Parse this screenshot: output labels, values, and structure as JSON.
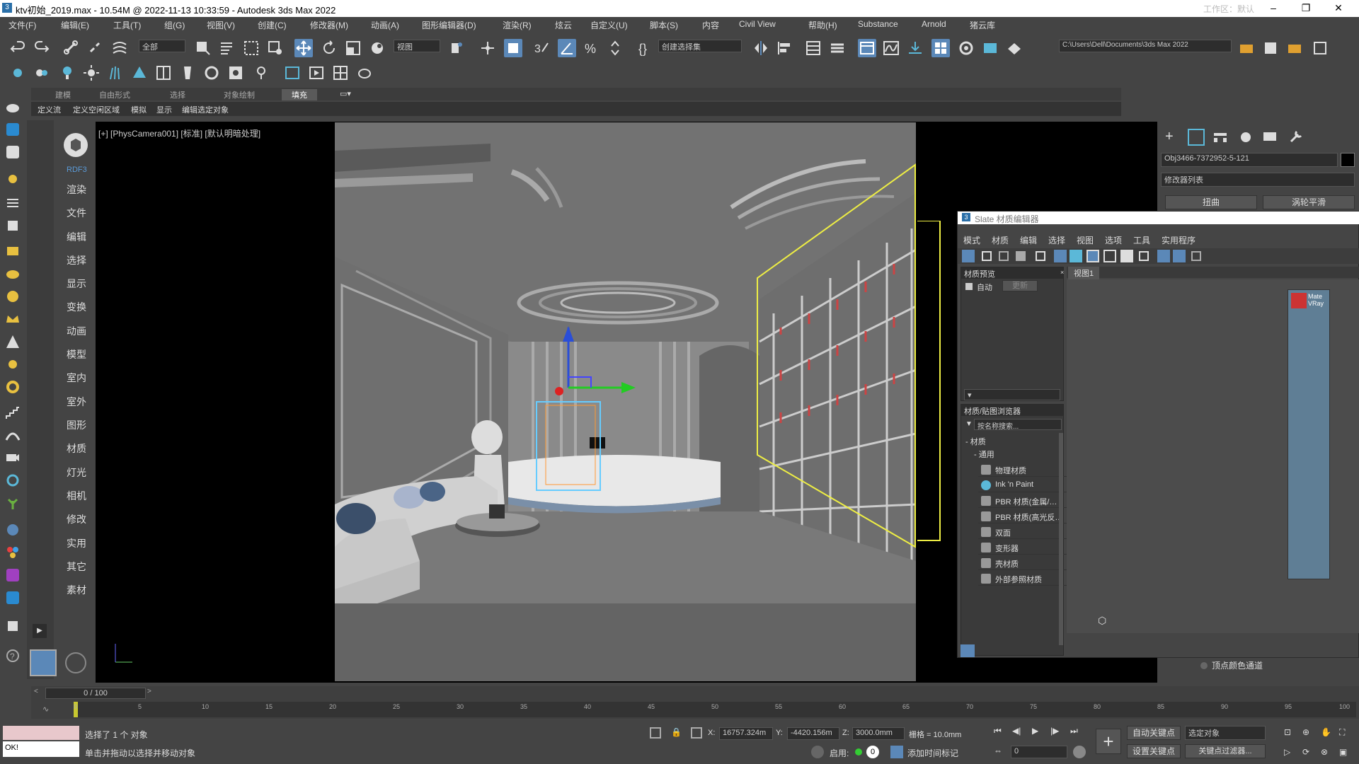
{
  "titlebar": {
    "title": "ktv初始_2019.max - 10.54M @ 2022-11-13 10:33:59 - Autodesk 3ds Max 2022",
    "overlay": "工作区：默认"
  },
  "menus": [
    "文件(F)",
    "编辑(E)",
    "工具(T)",
    "组(G)",
    "视图(V)",
    "创建(C)",
    "修改器(M)",
    "动画(A)",
    "图形编辑器(D)",
    "渲染(R)",
    "炫云",
    "自定义(U)",
    "脚本(S)",
    "内容",
    "Civil View",
    "帮助(H)",
    "Substance",
    "Arnold",
    "猪云库"
  ],
  "toolbar": {
    "selection_filter": "全部",
    "view_dropdown": "视图",
    "named_selection": "创建选择集",
    "path": "C:\\Users\\Dell\\Documents\\3ds Max 2022"
  },
  "ribbon": {
    "tabs": [
      "建模",
      "自由形式",
      "选择",
      "对象绘制",
      "填充"
    ],
    "tools": [
      "定义流",
      "定义空闲区域",
      "模拟",
      "显示",
      "编辑选定对象"
    ]
  },
  "leftpanel": {
    "logo": "RDF3",
    "items": [
      "渲染",
      "文件",
      "编辑",
      "选择",
      "显示",
      "变换",
      "动画",
      "模型",
      "室内",
      "室外",
      "图形",
      "材质",
      "灯光",
      "相机",
      "修改",
      "实用",
      "其它",
      "素材"
    ]
  },
  "viewport": {
    "label": "[+] [PhysCamera001] [标准] [默认明暗处理]"
  },
  "gizmo": {
    "z": "z",
    "y": "y"
  },
  "cmdpanel": {
    "object_name": "Obj3466-7372952-5-121",
    "modifier_list": "修改器列表",
    "btn1": "扭曲",
    "btn2": "涡轮平滑",
    "vertex_color": "顶点颜色通道"
  },
  "slate": {
    "title": "Slate 材质编辑器",
    "menu": [
      "模式",
      "材质",
      "编辑",
      "选择",
      "视图",
      "选项",
      "工具",
      "实用程序"
    ],
    "preview_title": "材质预览",
    "auto": "自动",
    "update": "更新",
    "view_tab": "视图1",
    "browser_title": "材质/贴图浏览器",
    "search": "按名称搜索...",
    "materials_group": "- 材质",
    "general_group": "- 通用",
    "materials": [
      "物理材质",
      "Ink 'n Paint",
      "PBR 材质(金属/…",
      "PBR 材质(高光反…",
      "双面",
      "变形器",
      "壳材质",
      "外部参照材质"
    ],
    "node_label": "Mate VRay"
  },
  "timeline": {
    "counter": "0 / 100",
    "ticks": [
      "0",
      "5",
      "10",
      "15",
      "20",
      "25",
      "30",
      "35",
      "40",
      "45",
      "50",
      "55",
      "60",
      "65",
      "70",
      "75",
      "80",
      "85",
      "90",
      "95",
      "100"
    ]
  },
  "status": {
    "selected": "选择了 1 个 对象",
    "hint": "单击并拖动以选择并移动对象",
    "ok": "OK!",
    "x_label": "X:",
    "x": "16757.324m",
    "y_label": "Y:",
    "y": "-4420.156m",
    "z_label": "Z:",
    "z": "3000.0mm",
    "grid": "栅格 = 10.0mm",
    "enable": "启用:",
    "add_time_tag": "添加时间标记",
    "auto_key": "自动关键点",
    "set_key": "设置关键点",
    "selected_obj": "选定对象",
    "key_filter": "关键点过滤器...",
    "frame": "0"
  }
}
